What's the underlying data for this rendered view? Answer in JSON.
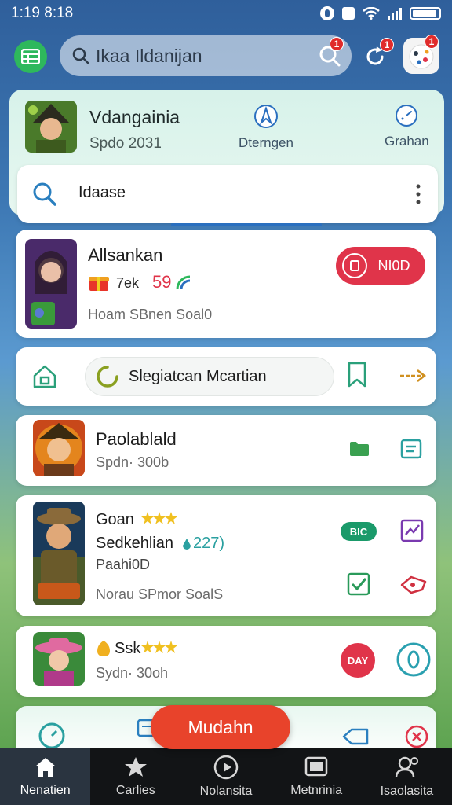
{
  "status_bar": {
    "time": "1:19 8:18"
  },
  "search": {
    "query": "Ikaa Ildanijan",
    "badge_count": "1"
  },
  "refresh": {
    "badge_count": "1"
  },
  "avatar": {
    "badge_count": "1"
  },
  "featured": {
    "title": "Vdangainia",
    "subtitle": "Spdo 2031",
    "quick_actions": [
      {
        "label": "Dterngen",
        "icon": "compass-icon"
      },
      {
        "label": "Grahan",
        "icon": "gauge-icon"
      }
    ],
    "tab_label": "Idaase"
  },
  "items": [
    {
      "title": "Allsankan",
      "reward": "7ek",
      "reward_value": "59",
      "meta": "Hoam SBnen Soal0",
      "action_label": "NI0D"
    },
    {
      "title": "Slegiatcan Mcartian"
    },
    {
      "title": "Paolablald",
      "meta": "Spdn· 300b"
    },
    {
      "title": "Goan",
      "subtitle": "Sedkehlian",
      "count": "227)",
      "detail": "Paahi0D",
      "meta": "Norau SPmor SoalS",
      "chip_label": "BIC"
    },
    {
      "title": "Ssk",
      "meta": "Sydn· 30oh",
      "action_label": "DAY"
    }
  ],
  "fab": {
    "label": "Mudahn"
  },
  "nav": [
    {
      "label": "Nenatien",
      "icon": "home-icon",
      "active": true
    },
    {
      "label": "Carlies",
      "icon": "star-icon"
    },
    {
      "label": "Nolansita",
      "icon": "play-icon"
    },
    {
      "label": "Metnrinia",
      "icon": "screen-icon"
    },
    {
      "label": "Isaolasita",
      "icon": "profile-icon"
    }
  ],
  "colors": {
    "accent": "#2a6fbf",
    "danger": "#e0344a",
    "success": "#2eb85c",
    "fab": "#e8432b"
  }
}
